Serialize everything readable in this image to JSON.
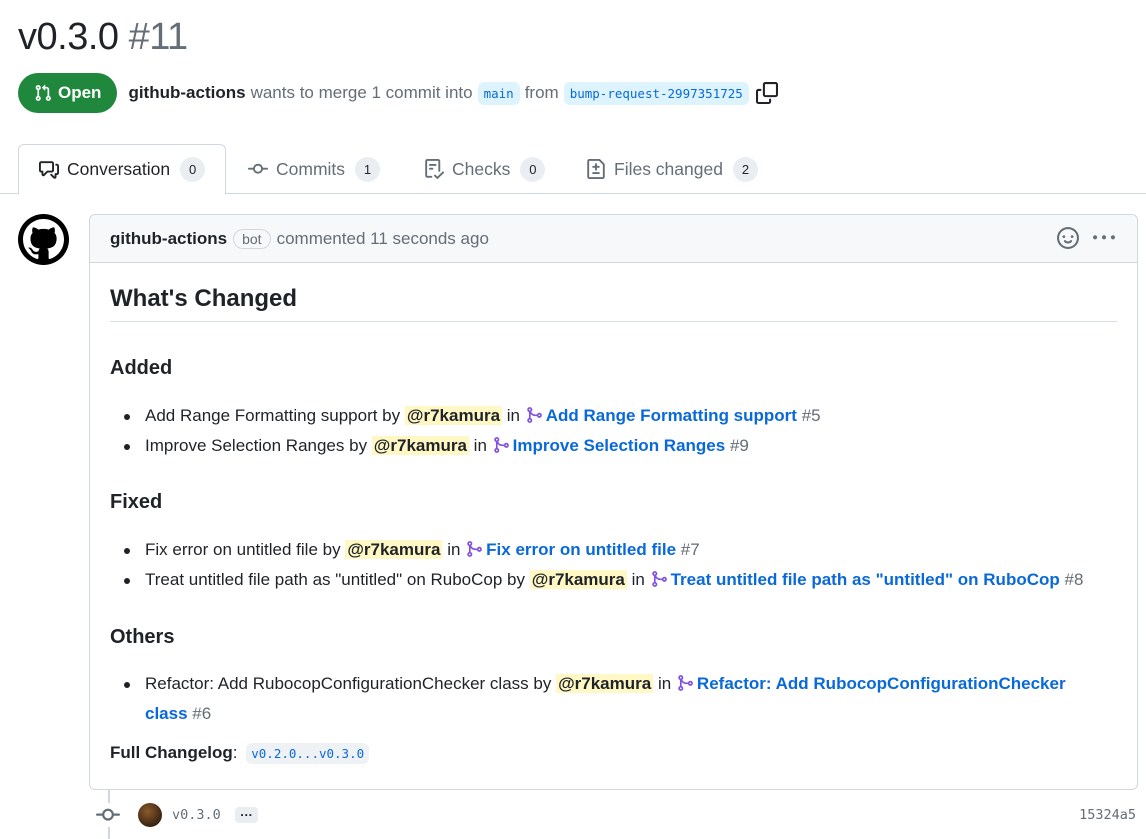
{
  "pr": {
    "title": "v0.3.0",
    "number": "#11",
    "state": "Open",
    "author": "github-actions",
    "merge_text": "wants to merge 1 commit into",
    "base_branch": "main",
    "from_text": "from",
    "head_branch": "bump-request-2997351725"
  },
  "tabs": [
    {
      "label": "Conversation",
      "count": "0",
      "icon": "comment-discussion-icon"
    },
    {
      "label": "Commits",
      "count": "1",
      "icon": "commit-icon"
    },
    {
      "label": "Checks",
      "count": "0",
      "icon": "checklist-icon"
    },
    {
      "label": "Files changed",
      "count": "2",
      "icon": "file-diff-icon"
    }
  ],
  "comment": {
    "author": "github-actions",
    "badge": "bot",
    "timestamp": "commented 11 seconds ago",
    "heading": "What's Changed",
    "sections": [
      {
        "title": "Added",
        "items": [
          {
            "text": "Add Range Formatting support by",
            "mention": "@r7kamura",
            "in": "in",
            "link": "Add Range Formatting support",
            "ref": "#5"
          },
          {
            "text": "Improve Selection Ranges by",
            "mention": "@r7kamura",
            "in": "in",
            "link": "Improve Selection Ranges",
            "ref": "#9"
          }
        ]
      },
      {
        "title": "Fixed",
        "items": [
          {
            "text": "Fix error on untitled file by",
            "mention": "@r7kamura",
            "in": "in",
            "link": "Fix error on untitled file",
            "ref": "#7"
          },
          {
            "text": "Treat untitled file path as \"untitled\" on RuboCop by",
            "mention": "@r7kamura",
            "in": "in",
            "link": "Treat untitled file path as \"untitled\" on RuboCop",
            "ref": "#8"
          }
        ]
      },
      {
        "title": "Others",
        "items": [
          {
            "text": "Refactor: Add RubocopConfigurationChecker class by",
            "mention": "@r7kamura",
            "in": "in",
            "link": "Refactor: Add RubocopConfigurationChecker class",
            "ref": "#6"
          }
        ]
      }
    ],
    "full_changelog_label": "Full Changelog",
    "full_changelog_colon": ":",
    "full_changelog_link": "v0.2.0...v0.3.0"
  },
  "commit": {
    "message": "v0.3.0",
    "ellipsis": "…",
    "sha": "15324a5"
  },
  "colors": {
    "open_green": "#1f883d",
    "link_blue": "#0969da",
    "mention_bg": "#fff8c5",
    "pr_icon_purple": "#8250df"
  }
}
